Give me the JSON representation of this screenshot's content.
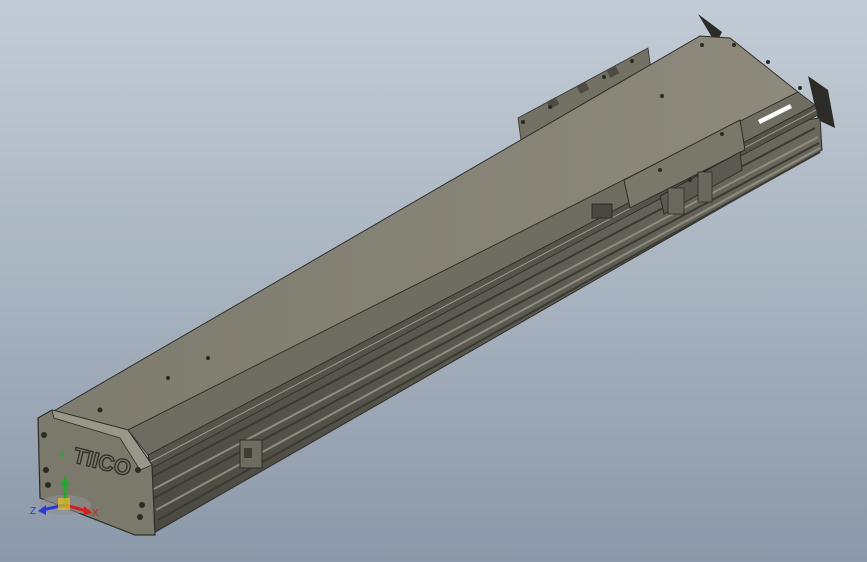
{
  "model": {
    "brand_logo": "TIICO"
  },
  "triad": {
    "x_label": "X",
    "y_label": "Y",
    "z_label": "Z",
    "colors": {
      "x": "#d22020",
      "y": "#22a82a",
      "z": "#2a3ad2"
    }
  }
}
